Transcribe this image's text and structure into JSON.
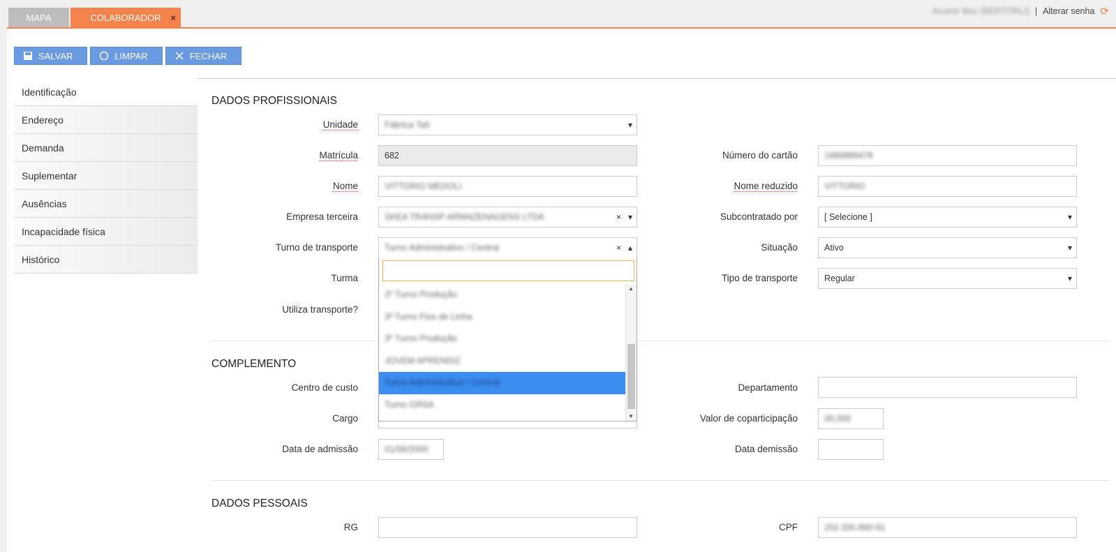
{
  "tabs": [
    {
      "label": "MAPA"
    },
    {
      "label": "COLABORADOR",
      "close": "×"
    }
  ],
  "topright": {
    "user": "Arcenir Beo (BERTORLI)",
    "separator": "|",
    "change_password": "Alterar senha",
    "refresh_icon": "refresh-icon"
  },
  "toolbar": {
    "save": "SALVAR",
    "clear": "LIMPAR",
    "close": "FECHAR"
  },
  "sidebar": {
    "items": [
      "Identificação",
      "Endereço",
      "Demanda",
      "Suplementar",
      "Ausências",
      "Incapacidade física",
      "Histórico"
    ]
  },
  "sections": {
    "prof": "DADOS PROFISSIONAIS",
    "comp": "COMPLEMENTO",
    "pess": "DADOS PESSOAIS"
  },
  "labels": {
    "unidade": "Unidade",
    "matricula": "Matrícula",
    "nome": "Nome",
    "empresa": "Empresa terceira",
    "turno": "Turno de transporte",
    "turma": "Turma",
    "utiliza": "Utiliza transporte?",
    "cartao": "Número do cartão",
    "nome_red": "Nome reduzido",
    "subcontratado": "Subcontratado por",
    "situacao": "Situação",
    "tipo_transporte": "Tipo de transporte",
    "centro_custo": "Centro de custo",
    "cargo": "Cargo",
    "data_admissao": "Data de admissão",
    "departamento": "Departamento",
    "valor_copart": "Valor de coparticipação",
    "data_demissao": "Data demissão",
    "rg": "RG",
    "cpf": "CPF"
  },
  "values": {
    "unidade": "Fábrica Tatí",
    "matricula": "682",
    "nome": "VITTORIO MEDOLI",
    "empresa": "SKEA TRANSP ARMAZENAGENS LTDA",
    "turno": "Turno Administrativo / Central",
    "cartao": "1686889478",
    "nome_red": "VITTORIO",
    "subcontratado": "[ Selecione ]",
    "situacao": "Ativo",
    "tipo_transporte": "Regular",
    "valor_copart": "00,000",
    "data_admissao": "01/06/2000",
    "cpf": "252.330.860-91"
  },
  "dropdown_options": [
    {
      "label": "2º Turno Produção"
    },
    {
      "label": "3º Turno Fios de Linha"
    },
    {
      "label": "3º Turno Produção"
    },
    {
      "label": "JOVEM APRENDIZ"
    },
    {
      "label": "Turno Administrativo / Central",
      "selected": true
    },
    {
      "label": "Turno GRSA"
    }
  ]
}
